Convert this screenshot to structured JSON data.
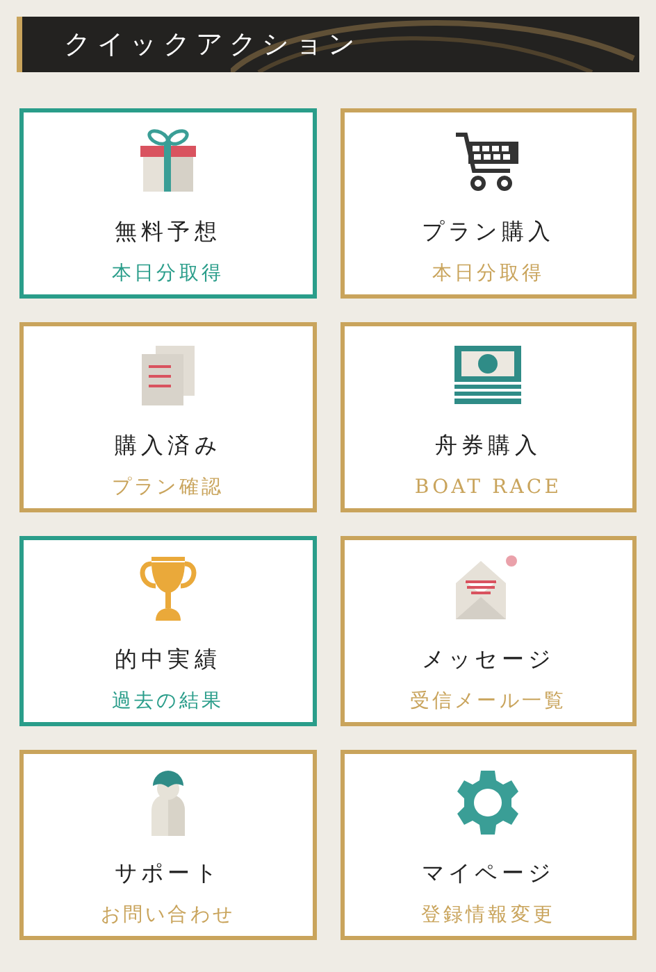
{
  "header": {
    "title": "クイックアクション"
  },
  "cards": [
    {
      "title": "無料予想",
      "subtitle": "本日分取得",
      "color": "#2a9d8a"
    },
    {
      "title": "プラン購入",
      "subtitle": "本日分取得",
      "color": "#c9a45c"
    },
    {
      "title": "購入済み",
      "subtitle": "プラン確認",
      "color": "#c9a45c"
    },
    {
      "title": "舟券購入",
      "subtitle": "BOAT RACE",
      "color": "#c9a45c"
    },
    {
      "title": "的中実績",
      "subtitle": "過去の結果",
      "color": "#2a9d8a"
    },
    {
      "title": "メッセージ",
      "subtitle": "受信メール一覧",
      "color": "#c9a45c"
    },
    {
      "title": "サポート",
      "subtitle": "お問い合わせ",
      "color": "#c9a45c"
    },
    {
      "title": "マイページ",
      "subtitle": "登録情報変更",
      "color": "#c9a45c"
    }
  ]
}
